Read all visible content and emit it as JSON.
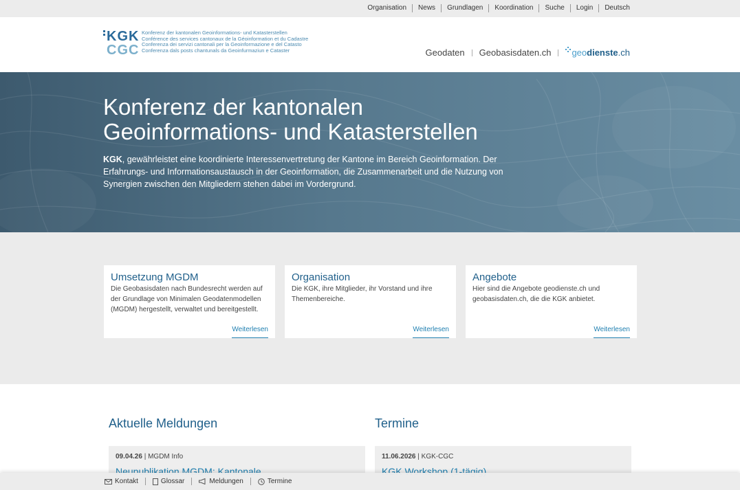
{
  "topnav": [
    "Organisation",
    "News",
    "Grundlagen",
    "Koordination",
    "Suche",
    "Login",
    "Deutsch"
  ],
  "logo": {
    "mark_top": "KGK",
    "mark_bottom": "CGC",
    "lines": [
      "Konferenz der kantonalen Geoinformations- und Katasterstellen",
      "Conférence des services cantonaux de la Géoinformation et du Cadastre",
      "Conferenza dei servizi cantonali per la Geoinformazione e del Catasto",
      "Conferenza dals posts chantunals da Geoinfurmaziun e Cataster"
    ]
  },
  "mainnav": {
    "geodaten": "Geodaten",
    "geobasisdaten": "Geobasisdaten.ch",
    "geodienste_pre": "geo",
    "geodienste_bold": "dienste",
    "geodienste_post": ".ch"
  },
  "hero": {
    "title_line1": "Konferenz der kantonalen",
    "title_line2": "Geoinformations- und Katasterstellen",
    "lead_bold": "KGK",
    "lead_text": ", gewährleistet eine koordinierte Interessenvertretung der Kantone im Bereich Geoinformation. Der Erfahrungs- und Informationsaustausch in der Geoinformation, die Zusammenarbeit und die Nutzung von Synergien zwischen den Mitgliedern stehen dabei im Vordergrund."
  },
  "cards": [
    {
      "title": "Umsetzung MGDM",
      "text": "Die Geobasisdaten nach Bundesrecht werden auf der Grundlage von Minimalen Geodatenmodellen (MGDM) hergestellt, verwaltet und bereitgestellt.",
      "more": "Weiterlesen"
    },
    {
      "title": "Organisation",
      "text": "Die KGK, ihre Mitglieder, ihr Vorstand und ihre Themenbereiche.",
      "more": "Weiterlesen"
    },
    {
      "title": "Angebote",
      "text": "Hier sind die Angebote geodienste.ch und geobasisdaten.ch, die die KGK anbietet.",
      "more": "Weiterlesen"
    }
  ],
  "news": {
    "title": "Aktuelle Meldungen",
    "date": "09.04.26",
    "category": " | MGDM Info",
    "headline": "Neupublikation MGDM: Kantonale"
  },
  "events": {
    "title": "Termine",
    "date": "11.06.2026",
    "category": " | KGK-CGC",
    "headline": "KGK Workshop (1-tägig)"
  },
  "bottombar": {
    "kontakt": "Kontakt",
    "glossar": "Glossar",
    "meldungen": "Meldungen",
    "termine": "Termine"
  },
  "colors": {
    "brand_blue": "#1f5f8a",
    "link_blue": "#1f7fb0",
    "hero_bg": "#56788d"
  }
}
